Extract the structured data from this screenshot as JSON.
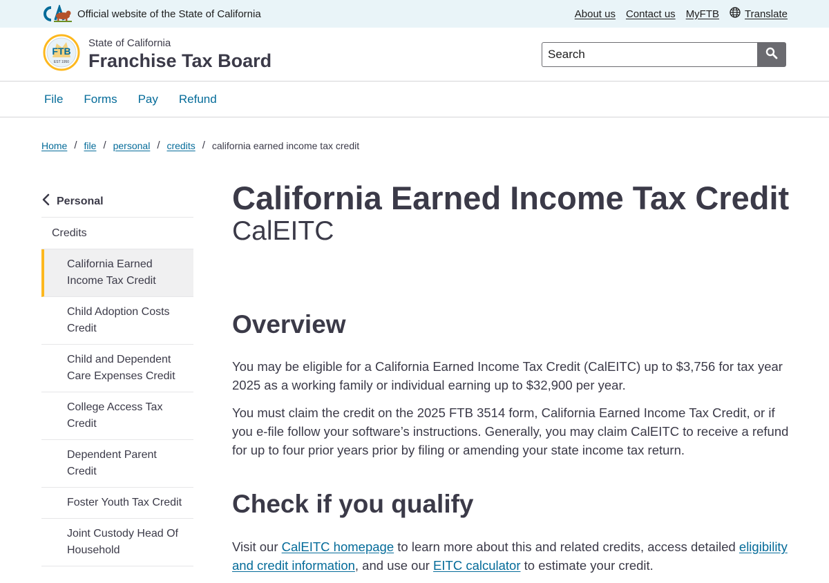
{
  "utility": {
    "official_text": "Official website of the State of California",
    "links": {
      "about": "About us",
      "contact": "Contact us",
      "myftb": "MyFTB",
      "translate": "Translate"
    }
  },
  "brand": {
    "sub": "State of California",
    "title": "Franchise Tax Board",
    "seal_text": "FTB",
    "seal_est": "EST 1950"
  },
  "search": {
    "placeholder": "Search"
  },
  "nav": {
    "file": "File",
    "forms": "Forms",
    "pay": "Pay",
    "refund": "Refund"
  },
  "breadcrumb": {
    "home": "Home",
    "file": "file",
    "personal": "personal",
    "credits": "credits",
    "current": "california earned income tax credit"
  },
  "sidebar": {
    "parent": "Personal",
    "section": "Credits",
    "items": [
      "California Earned Income Tax Credit",
      "Child Adoption Costs Credit",
      "Child and Dependent Care Expenses Credit",
      "College Access Tax Credit",
      "Dependent Parent Credit",
      "Foster Youth Tax Credit",
      "Joint Custody Head Of Household"
    ]
  },
  "main": {
    "title": "California Earned Income Tax Credit",
    "subtitle": "CalEITC",
    "overview_heading": "Overview",
    "p1": "You may be eligible for a California Earned Income Tax Credit (CalEITC) up to $3,756 for tax year 2025 as a working family or individual earning up to $32,900 per year.",
    "p2": "You must claim the credit on the 2025 FTB 3514 form, California Earned Income Tax Credit, or if you e-file follow your software’s instructions. Generally, you may claim CalEITC to receive a refund for up to four prior years prior by filing or amending your state income tax return.",
    "qualify_heading": "Check if you qualify",
    "p3": {
      "t1": "Visit our ",
      "link1": "CalEITC homepage",
      "t2": " to learn more about this and related credits, access detailed ",
      "link2": "eligibility and credit information",
      "t3": ", and use our ",
      "link3": "EITC calculator",
      "t4": " to estimate your credit."
    }
  },
  "colors": {
    "link": "#046b99",
    "text": "#3b3a48",
    "accent_gold": "#fdb81e",
    "utility_bg": "#e9f4f8"
  },
  "icons": {
    "ca_logo": "ca-bear-logo-icon",
    "globe": "globe-icon",
    "search": "search-icon",
    "back": "chevron-left-icon"
  }
}
